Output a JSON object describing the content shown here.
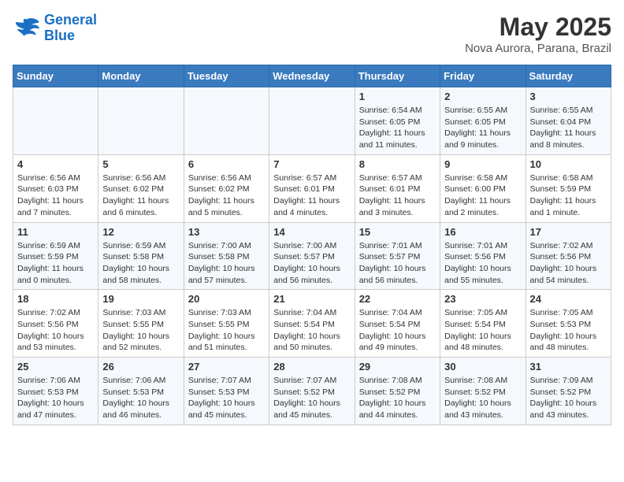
{
  "header": {
    "logo_line1": "General",
    "logo_line2": "Blue",
    "month": "May 2025",
    "location": "Nova Aurora, Parana, Brazil"
  },
  "weekdays": [
    "Sunday",
    "Monday",
    "Tuesday",
    "Wednesday",
    "Thursday",
    "Friday",
    "Saturday"
  ],
  "weeks": [
    [
      {
        "day": "",
        "info": ""
      },
      {
        "day": "",
        "info": ""
      },
      {
        "day": "",
        "info": ""
      },
      {
        "day": "",
        "info": ""
      },
      {
        "day": "1",
        "info": "Sunrise: 6:54 AM\nSunset: 6:05 PM\nDaylight: 11 hours and 11 minutes."
      },
      {
        "day": "2",
        "info": "Sunrise: 6:55 AM\nSunset: 6:05 PM\nDaylight: 11 hours and 9 minutes."
      },
      {
        "day": "3",
        "info": "Sunrise: 6:55 AM\nSunset: 6:04 PM\nDaylight: 11 hours and 8 minutes."
      }
    ],
    [
      {
        "day": "4",
        "info": "Sunrise: 6:56 AM\nSunset: 6:03 PM\nDaylight: 11 hours and 7 minutes."
      },
      {
        "day": "5",
        "info": "Sunrise: 6:56 AM\nSunset: 6:02 PM\nDaylight: 11 hours and 6 minutes."
      },
      {
        "day": "6",
        "info": "Sunrise: 6:56 AM\nSunset: 6:02 PM\nDaylight: 11 hours and 5 minutes."
      },
      {
        "day": "7",
        "info": "Sunrise: 6:57 AM\nSunset: 6:01 PM\nDaylight: 11 hours and 4 minutes."
      },
      {
        "day": "8",
        "info": "Sunrise: 6:57 AM\nSunset: 6:01 PM\nDaylight: 11 hours and 3 minutes."
      },
      {
        "day": "9",
        "info": "Sunrise: 6:58 AM\nSunset: 6:00 PM\nDaylight: 11 hours and 2 minutes."
      },
      {
        "day": "10",
        "info": "Sunrise: 6:58 AM\nSunset: 5:59 PM\nDaylight: 11 hours and 1 minute."
      }
    ],
    [
      {
        "day": "11",
        "info": "Sunrise: 6:59 AM\nSunset: 5:59 PM\nDaylight: 11 hours and 0 minutes."
      },
      {
        "day": "12",
        "info": "Sunrise: 6:59 AM\nSunset: 5:58 PM\nDaylight: 10 hours and 58 minutes."
      },
      {
        "day": "13",
        "info": "Sunrise: 7:00 AM\nSunset: 5:58 PM\nDaylight: 10 hours and 57 minutes."
      },
      {
        "day": "14",
        "info": "Sunrise: 7:00 AM\nSunset: 5:57 PM\nDaylight: 10 hours and 56 minutes."
      },
      {
        "day": "15",
        "info": "Sunrise: 7:01 AM\nSunset: 5:57 PM\nDaylight: 10 hours and 56 minutes."
      },
      {
        "day": "16",
        "info": "Sunrise: 7:01 AM\nSunset: 5:56 PM\nDaylight: 10 hours and 55 minutes."
      },
      {
        "day": "17",
        "info": "Sunrise: 7:02 AM\nSunset: 5:56 PM\nDaylight: 10 hours and 54 minutes."
      }
    ],
    [
      {
        "day": "18",
        "info": "Sunrise: 7:02 AM\nSunset: 5:56 PM\nDaylight: 10 hours and 53 minutes."
      },
      {
        "day": "19",
        "info": "Sunrise: 7:03 AM\nSunset: 5:55 PM\nDaylight: 10 hours and 52 minutes."
      },
      {
        "day": "20",
        "info": "Sunrise: 7:03 AM\nSunset: 5:55 PM\nDaylight: 10 hours and 51 minutes."
      },
      {
        "day": "21",
        "info": "Sunrise: 7:04 AM\nSunset: 5:54 PM\nDaylight: 10 hours and 50 minutes."
      },
      {
        "day": "22",
        "info": "Sunrise: 7:04 AM\nSunset: 5:54 PM\nDaylight: 10 hours and 49 minutes."
      },
      {
        "day": "23",
        "info": "Sunrise: 7:05 AM\nSunset: 5:54 PM\nDaylight: 10 hours and 48 minutes."
      },
      {
        "day": "24",
        "info": "Sunrise: 7:05 AM\nSunset: 5:53 PM\nDaylight: 10 hours and 48 minutes."
      }
    ],
    [
      {
        "day": "25",
        "info": "Sunrise: 7:06 AM\nSunset: 5:53 PM\nDaylight: 10 hours and 47 minutes."
      },
      {
        "day": "26",
        "info": "Sunrise: 7:06 AM\nSunset: 5:53 PM\nDaylight: 10 hours and 46 minutes."
      },
      {
        "day": "27",
        "info": "Sunrise: 7:07 AM\nSunset: 5:53 PM\nDaylight: 10 hours and 45 minutes."
      },
      {
        "day": "28",
        "info": "Sunrise: 7:07 AM\nSunset: 5:52 PM\nDaylight: 10 hours and 45 minutes."
      },
      {
        "day": "29",
        "info": "Sunrise: 7:08 AM\nSunset: 5:52 PM\nDaylight: 10 hours and 44 minutes."
      },
      {
        "day": "30",
        "info": "Sunrise: 7:08 AM\nSunset: 5:52 PM\nDaylight: 10 hours and 43 minutes."
      },
      {
        "day": "31",
        "info": "Sunrise: 7:09 AM\nSunset: 5:52 PM\nDaylight: 10 hours and 43 minutes."
      }
    ]
  ]
}
